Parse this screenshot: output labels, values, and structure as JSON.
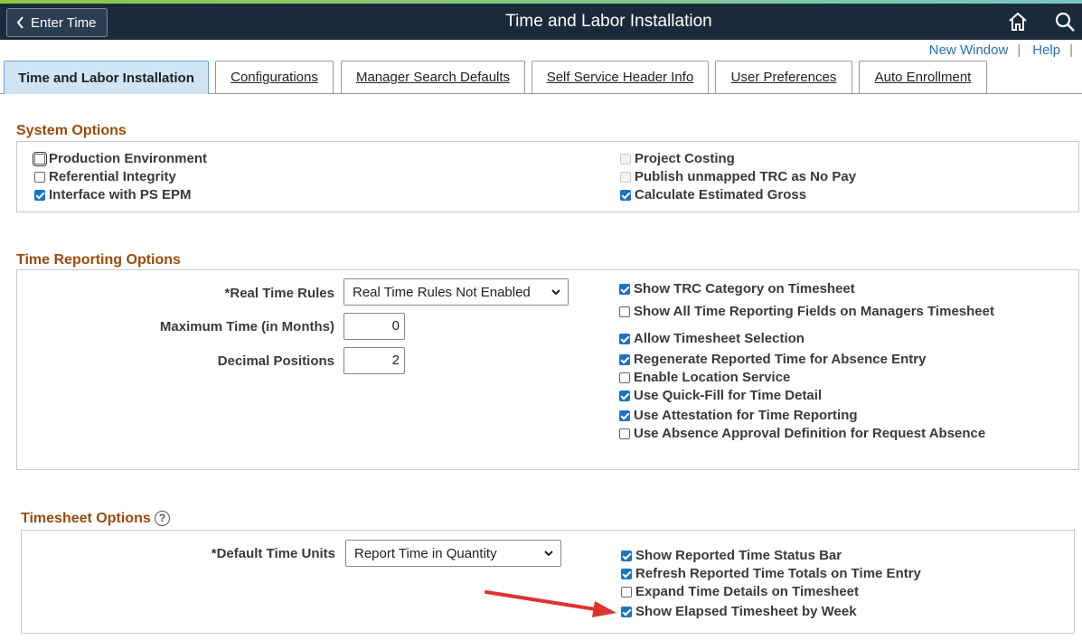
{
  "header": {
    "back_label": "Enter Time",
    "title": "Time and Labor Installation",
    "home_icon": "home-icon",
    "search_icon": "search-icon"
  },
  "links": {
    "new_window": "New Window",
    "help": "Help"
  },
  "tabs": [
    {
      "label": "Time and Labor Installation",
      "active": true
    },
    {
      "label": "Configurations"
    },
    {
      "label": "Manager Search Defaults"
    },
    {
      "label": "Self Service Header Info"
    },
    {
      "label": "User Preferences"
    },
    {
      "label": "Auto Enrollment"
    }
  ],
  "system_options": {
    "title": "System Options",
    "left": [
      {
        "label": "Production Environment",
        "checked": false
      },
      {
        "label": "Referential Integrity",
        "checked": false
      },
      {
        "label": "Interface with PS EPM",
        "checked": true
      }
    ],
    "right": [
      {
        "label": "Project Costing",
        "checked": false,
        "disabled": true
      },
      {
        "label": "Publish unmapped TRC as No Pay",
        "checked": false,
        "disabled": true
      },
      {
        "label": "Calculate Estimated Gross",
        "checked": true
      }
    ]
  },
  "time_reporting": {
    "title": "Time Reporting Options",
    "real_time_rules_label": "*Real Time Rules",
    "real_time_rules_value": "Real Time Rules Not Enabled",
    "max_time_label": "Maximum Time (in Months)",
    "max_time_value": "0",
    "decimal_label": "Decimal Positions",
    "decimal_value": "2",
    "checks": [
      {
        "label": "Show TRC Category on Timesheet",
        "checked": true
      },
      {
        "label": "Show All Time Reporting Fields on Managers Timesheet",
        "checked": false
      },
      {
        "label": "Allow Timesheet Selection",
        "checked": true
      },
      {
        "label": "Regenerate Reported Time for Absence Entry",
        "checked": true
      },
      {
        "label": "Enable Location Service",
        "checked": false
      },
      {
        "label": "Use Quick-Fill for Time Detail",
        "checked": true
      },
      {
        "label": "Use Attestation for Time Reporting",
        "checked": true
      },
      {
        "label": "Use Absence Approval Definition for Request Absence",
        "checked": false
      }
    ]
  },
  "timesheet_options": {
    "title": "Timesheet Options",
    "help_icon": "?",
    "default_units_label": "*Default Time Units",
    "default_units_value": "Report Time in Quantity",
    "checks": [
      {
        "label": "Show Reported Time Status Bar",
        "checked": true
      },
      {
        "label": "Refresh Reported Time Totals on Time Entry",
        "checked": true
      },
      {
        "label": "Expand Time Details on Timesheet",
        "checked": false
      },
      {
        "label": "Show Elapsed Timesheet by Week",
        "checked": true
      }
    ]
  }
}
